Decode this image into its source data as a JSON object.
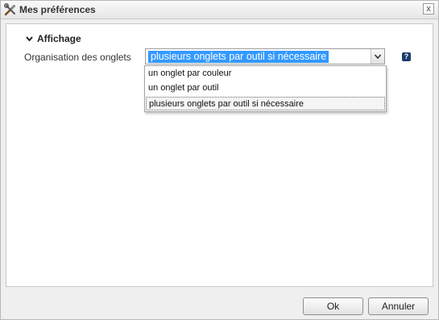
{
  "dialog": {
    "title": "Mes préférences",
    "title_icon": "tools-icon",
    "close_label": "x"
  },
  "section": {
    "title": "Affichage"
  },
  "field": {
    "label": "Organisation des onglets",
    "selected_value": "plusieurs onglets par outil si nécessaire",
    "options": [
      "un onglet par couleur",
      "un onglet par outil",
      "plusieurs onglets par outil si nécessaire"
    ],
    "help_label": "?"
  },
  "buttons": {
    "ok": "Ok",
    "cancel": "Annuler"
  },
  "colors": {
    "selection": "#3399ff",
    "help_icon": "#1a3a6b"
  }
}
